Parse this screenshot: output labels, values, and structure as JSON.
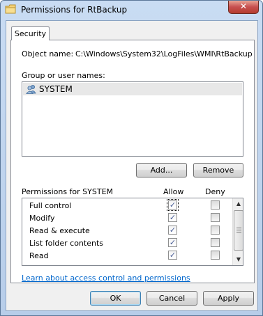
{
  "window": {
    "title": "Permissions for RtBackup",
    "close_glyph": "✕"
  },
  "tabs": [
    {
      "label": "Security"
    }
  ],
  "object": {
    "label": "Object name:",
    "value": "C:\\Windows\\System32\\LogFiles\\WMI\\RtBackup"
  },
  "groups": {
    "label": "Group or user names:",
    "items": [
      {
        "name": "SYSTEM",
        "icon": "user-group-icon"
      }
    ]
  },
  "buttons": {
    "add": "Add...",
    "remove": "Remove",
    "ok": "OK",
    "cancel": "Cancel",
    "apply": "Apply"
  },
  "permissions": {
    "header_label": "Permissions for SYSTEM",
    "allow_label": "Allow",
    "deny_label": "Deny",
    "rows": [
      {
        "name": "Full control",
        "allow": true,
        "deny": false
      },
      {
        "name": "Modify",
        "allow": true,
        "deny": false
      },
      {
        "name": "Read & execute",
        "allow": true,
        "deny": false
      },
      {
        "name": "List folder contents",
        "allow": true,
        "deny": false
      },
      {
        "name": "Read",
        "allow": true,
        "deny": false
      }
    ]
  },
  "link": {
    "text": "Learn about access control and permissions"
  }
}
